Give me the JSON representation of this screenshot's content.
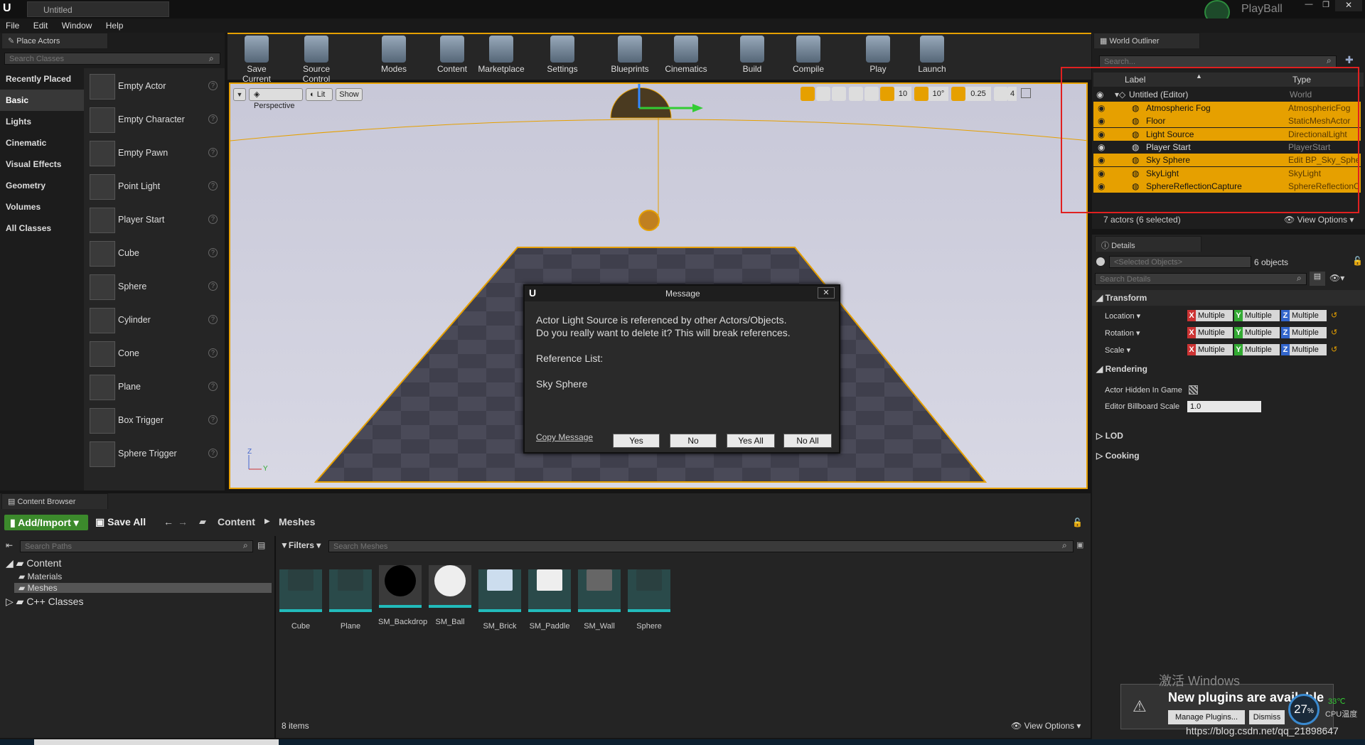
{
  "window": {
    "tab_title": "Untitled",
    "project_name": "PlayBall"
  },
  "menu": [
    "File",
    "Edit",
    "Window",
    "Help"
  ],
  "place_actors": {
    "tab": "Place Actors",
    "search_placeholder": "Search Classes",
    "categories": [
      "Recently Placed",
      "Basic",
      "Lights",
      "Cinematic",
      "Visual Effects",
      "Geometry",
      "Volumes",
      "All Classes"
    ],
    "active_category": "Basic",
    "actors": [
      "Empty Actor",
      "Empty Character",
      "Empty Pawn",
      "Point Light",
      "Player Start",
      "Cube",
      "Sphere",
      "Cylinder",
      "Cone",
      "Plane",
      "Box Trigger",
      "Sphere Trigger"
    ]
  },
  "toolbar": [
    {
      "label": "Save Current",
      "icon": "save-icon"
    },
    {
      "label": "Source Control",
      "icon": "source-control-icon"
    },
    {
      "label": "Modes",
      "icon": "modes-icon"
    },
    {
      "label": "Content",
      "icon": "content-icon"
    },
    {
      "label": "Marketplace",
      "icon": "marketplace-icon"
    },
    {
      "label": "Settings",
      "icon": "settings-icon"
    },
    {
      "label": "Blueprints",
      "icon": "blueprints-icon"
    },
    {
      "label": "Cinematics",
      "icon": "cinematics-icon"
    },
    {
      "label": "Build",
      "icon": "build-icon"
    },
    {
      "label": "Compile",
      "icon": "compile-icon"
    },
    {
      "label": "Play",
      "icon": "play-icon"
    },
    {
      "label": "Launch",
      "icon": "launch-icon"
    }
  ],
  "viewport": {
    "perspective": "Perspective",
    "lit": "Lit",
    "show": "Show",
    "grid_snap": "10",
    "rot_snap": "10°",
    "scale_snap": "0.25",
    "camera_speed": "4"
  },
  "dialog": {
    "title": "Message",
    "line1": "Actor Light Source is referenced by other Actors/Objects.",
    "line2": "Do you really want to delete it? This will break references.",
    "ref_title": "Reference List:",
    "ref_item": "Sky Sphere",
    "copy": "Copy Message",
    "buttons": [
      "Yes",
      "No",
      "Yes All",
      "No All"
    ]
  },
  "outliner": {
    "tab": "World Outliner",
    "search_placeholder": "Search...",
    "col_label": "Label",
    "col_type": "Type",
    "root": {
      "label": "Untitled (Editor)",
      "type": "World"
    },
    "rows": [
      {
        "label": "Atmospheric Fog",
        "type": "AtmosphericFog",
        "selected": true
      },
      {
        "label": "Floor",
        "type": "StaticMeshActor",
        "selected": true
      },
      {
        "label": "Light Source",
        "type": "DirectionalLight",
        "selected": true
      },
      {
        "label": "Player Start",
        "type": "PlayerStart",
        "selected": false
      },
      {
        "label": "Sky Sphere",
        "type": "Edit BP_Sky_Sphe",
        "selected": true
      },
      {
        "label": "SkyLight",
        "type": "SkyLight",
        "selected": true
      },
      {
        "label": "SphereReflectionCapture",
        "type": "SphereReflectionC",
        "selected": true
      }
    ],
    "status": "7 actors (6 selected)",
    "view_options": "View Options"
  },
  "details": {
    "tab": "Details",
    "selected_placeholder": "<Selected Objects>",
    "count": "6 objects",
    "search_placeholder": "Search Details",
    "transform": "Transform",
    "location": "Location",
    "rotation": "Rotation",
    "scale": "Scale",
    "multiple": "Multiple",
    "rendering": "Rendering",
    "hidden_label": "Actor Hidden In Game",
    "billboard_label": "Editor Billboard Scale",
    "billboard_value": "1.0",
    "lod": "LOD",
    "cooking": "Cooking"
  },
  "content_browser": {
    "tab": "Content Browser",
    "add_import": "Add/Import",
    "save_all": "Save All",
    "path": [
      "Content",
      "Meshes"
    ],
    "search_paths": "Search Paths",
    "filters": "Filters",
    "search_meshes": "Search Meshes",
    "tree": {
      "root": "Content",
      "children": [
        "Materials",
        "Meshes"
      ],
      "cpp": "C++ Classes"
    },
    "items": [
      "Cube",
      "Plane",
      "SM_Backdrop",
      "SM_Ball",
      "SM_Brick",
      "SM_Paddle",
      "SM_Wall",
      "Sphere"
    ],
    "count": "8 items",
    "view_options": "View Options"
  },
  "notification": {
    "text": "New plugins are available",
    "manage": "Manage Plugins...",
    "dismiss": "Dismiss"
  },
  "watermark": {
    "windows": "激活 Windows",
    "url": "https://blog.csdn.net/qq_21898647"
  },
  "cpu": {
    "percent": "27",
    "unit": "%",
    "temp": "33℃",
    "label": "CPU温度"
  },
  "colors": {
    "accent": "#e6a000",
    "highlight_box": "#e02020",
    "teal": "#2bb4b4"
  }
}
